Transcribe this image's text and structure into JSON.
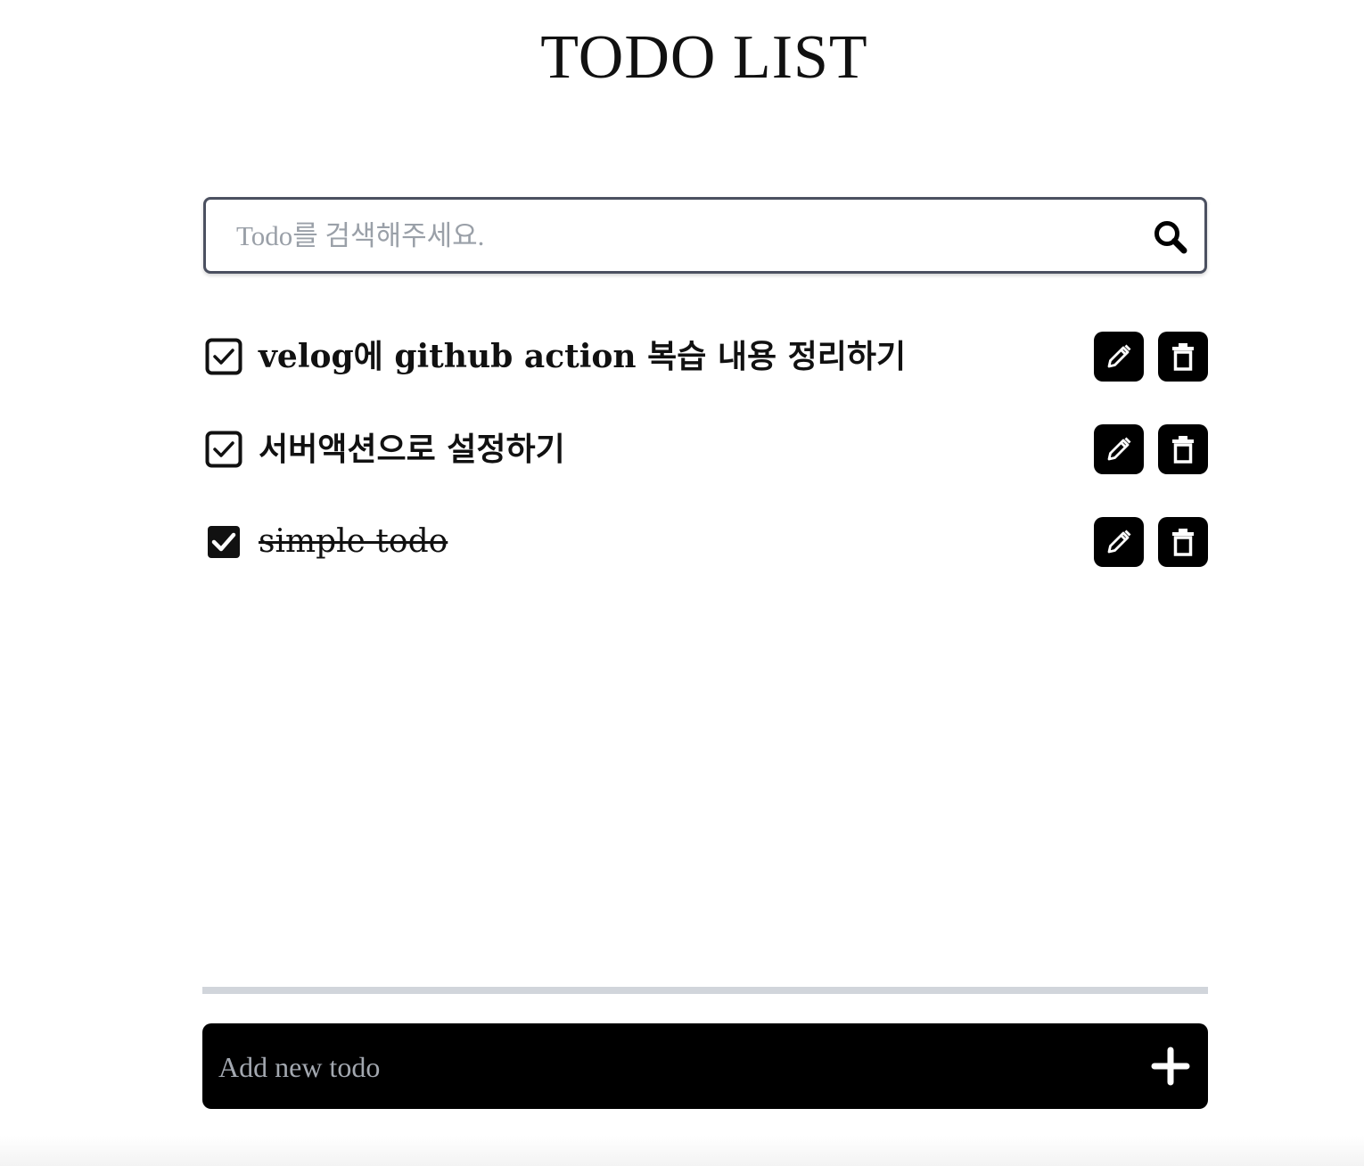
{
  "header": {
    "title": "TODO LIST"
  },
  "search": {
    "placeholder": "Todo를 검색해주세요.",
    "value": "",
    "icon": "search-icon"
  },
  "todos": [
    {
      "text": "velog에 github action 복습 내용 정리하기",
      "completed": false
    },
    {
      "text": "서버액션으로 설정하기",
      "completed": false
    },
    {
      "text": "simple todo",
      "completed": true
    }
  ],
  "row_actions": {
    "edit_icon": "pencil-icon",
    "delete_icon": "trash-icon"
  },
  "add_todo": {
    "placeholder": "Add new todo",
    "value": "",
    "icon": "plus-icon"
  },
  "colors": {
    "text": "#111111",
    "button_bg": "#000000",
    "search_border": "#4b5060",
    "placeholder": "#9aa0a8",
    "divider": "#d1d5db"
  }
}
